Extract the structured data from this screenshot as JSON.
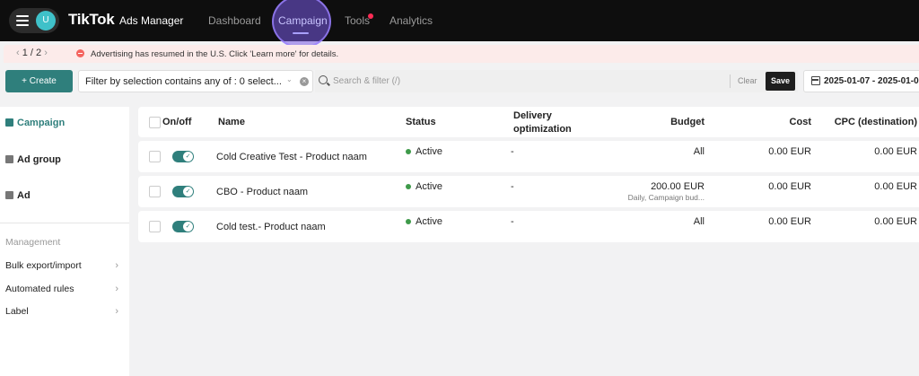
{
  "topbar": {
    "avatar_initial": "U",
    "brand": "TikTok",
    "brand_sub": "Ads Manager",
    "nav": {
      "dashboard": "Dashboard",
      "campaign": "Campaign",
      "tools": "Tools",
      "analytics": "Analytics"
    },
    "accent_color": "#a9a0ff"
  },
  "notice": {
    "pager": "1 / 2",
    "text": "Advertising has resumed in the U.S. Click 'Learn more' for details."
  },
  "toolbar": {
    "create_label": "+ Create",
    "filter_text": "Filter by selection contains any of : 0 select...",
    "search_placeholder": "Search & filter (/)",
    "clear_label": "Clear",
    "save_label": "Save",
    "date_range": "2025-01-07 - 2025-01-0"
  },
  "sidebar": {
    "items": [
      {
        "label": "Campaign",
        "icon": "folder-icon",
        "active": true
      },
      {
        "label": "Ad group",
        "icon": "document-icon",
        "active": false
      },
      {
        "label": "Ad",
        "icon": "document-icon",
        "active": false
      }
    ],
    "management_heading": "Management",
    "management_links": [
      {
        "label": "Bulk export/import"
      },
      {
        "label": "Automated rules"
      },
      {
        "label": "Label"
      }
    ]
  },
  "table": {
    "headers": {
      "onoff": "On/off",
      "name": "Name",
      "status": "Status",
      "delivery_line1": "Delivery",
      "delivery_line2": "optimization",
      "budget": "Budget",
      "cost": "Cost",
      "cpc": "CPC (destination)"
    },
    "rows": [
      {
        "name": "Cold Creative Test - Product naam",
        "status": "Active",
        "delivery": "-",
        "budget": "All",
        "budget_sub": "",
        "cost": "0.00 EUR",
        "cpc": "0.00 EUR"
      },
      {
        "name": "CBO - Product naam",
        "status": "Active",
        "delivery": "-",
        "budget": "200.00 EUR",
        "budget_sub": "Daily, Campaign bud...",
        "cost": "0.00 EUR",
        "cpc": "0.00 EUR"
      },
      {
        "name": "Cold test.- Product naam",
        "status": "Active",
        "delivery": "-",
        "budget": "All",
        "budget_sub": "",
        "cost": "0.00 EUR",
        "cpc": "0.00 EUR"
      }
    ],
    "status_color": "#3e9a4a"
  }
}
